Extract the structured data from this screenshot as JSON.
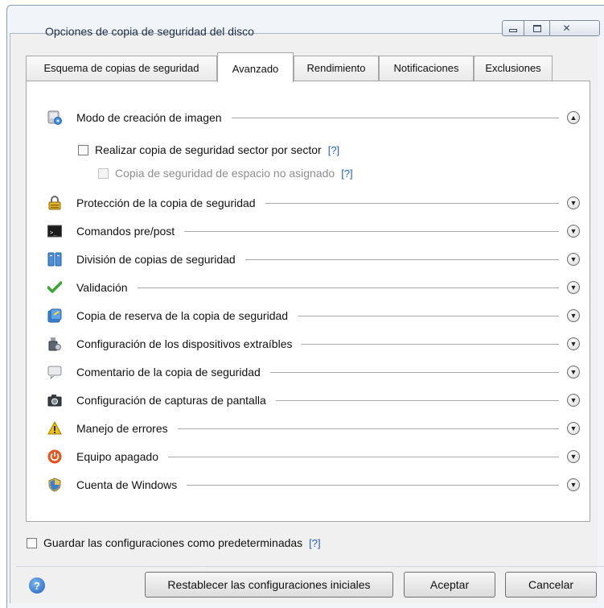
{
  "window": {
    "title": "Opciones de copia de seguridad del disco"
  },
  "tabs": [
    {
      "label": "Esquema de copias de seguridad",
      "active": false
    },
    {
      "label": "Avanzado",
      "active": true
    },
    {
      "label": "Rendimiento",
      "active": false
    },
    {
      "label": "Notificaciones",
      "active": false
    },
    {
      "label": "Exclusiones",
      "active": false
    }
  ],
  "sections": [
    {
      "label": "Modo de creación de imagen",
      "icon": "disk-image-icon",
      "expanded": true
    },
    {
      "label": "Protección de la copia de seguridad",
      "icon": "lock-icon",
      "expanded": false
    },
    {
      "label": "Comandos pre/post",
      "icon": "terminal-icon",
      "expanded": false
    },
    {
      "label": "División de copias de seguridad",
      "icon": "split-archive-icon",
      "expanded": false
    },
    {
      "label": "Validación",
      "icon": "checkmark-icon",
      "expanded": false
    },
    {
      "label": "Copia de reserva de la copia de seguridad",
      "icon": "reserve-copy-icon",
      "expanded": false
    },
    {
      "label": "Configuración de los dispositivos extraíbles",
      "icon": "usb-device-icon",
      "expanded": false
    },
    {
      "label": "Comentario de la copia de seguridad",
      "icon": "comment-icon",
      "expanded": false
    },
    {
      "label": "Configuración de capturas de pantalla",
      "icon": "camera-icon",
      "expanded": false
    },
    {
      "label": "Manejo de errores",
      "icon": "warning-icon",
      "expanded": false
    },
    {
      "label": "Equipo apagado",
      "icon": "power-icon",
      "expanded": false
    },
    {
      "label": "Cuenta de Windows",
      "icon": "windows-shield-icon",
      "expanded": false
    }
  ],
  "image_mode": {
    "sector_by_sector_label": "Realizar copia de seguridad sector por sector",
    "sector_by_sector_checked": false,
    "sector_help": "[?]",
    "unallocated_label": "Copia de seguridad de espacio no asignado",
    "unallocated_checked": false,
    "unallocated_enabled": false,
    "unallocated_help": "[?]"
  },
  "save_default": {
    "label": "Guardar las configuraciones como predeterminadas",
    "checked": false,
    "help": "[?]"
  },
  "footer": {
    "help_glyph": "?",
    "reset_label": "Restablecer las configuraciones iniciales",
    "ok_label": "Aceptar",
    "cancel_label": "Cancelar"
  },
  "colors": {
    "help_link": "#1f5fbf",
    "window_chrome": "#f1f5fa",
    "validation_green": "#3aa832",
    "power_orange": "#e8531c",
    "warning_yellow": "#f2c500"
  }
}
